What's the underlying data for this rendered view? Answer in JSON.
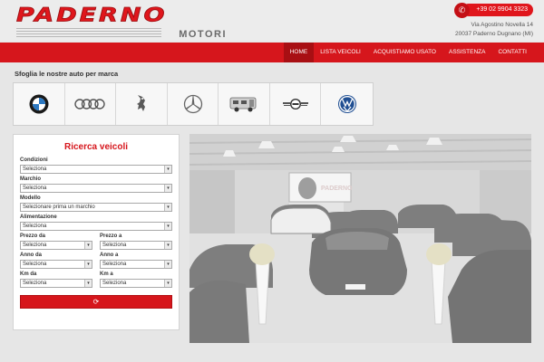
{
  "header": {
    "logo_main": "PADERNO",
    "logo_sub": "MOTORI",
    "phone": "+39 02 9904 3323",
    "address_line1": "Via Agostino Novella 14",
    "address_line2": "20037 Paderno Dugnano (MI)"
  },
  "nav": {
    "items": [
      "HOME",
      "LISTA VEICOLI",
      "ACQUISTIAMO USATO",
      "ASSISTENZA",
      "CONTATTI"
    ],
    "active": "HOME"
  },
  "brands": {
    "title": "Sfoglia le nostre auto per marca",
    "logos": [
      "bmw-logo",
      "audi-logo",
      "peugeot-logo",
      "mercedes-logo",
      "camper-logo",
      "mini-logo",
      "volkswagen-logo"
    ]
  },
  "search": {
    "title": "Ricerca veicoli",
    "fields": {
      "condizioni": {
        "label": "Condizioni",
        "value": "Seleziona"
      },
      "marchio": {
        "label": "Marchio",
        "value": "Seleziona"
      },
      "modello": {
        "label": "Modello",
        "value": "Selezionare prima un marchio"
      },
      "alimentazione": {
        "label": "Alimentazione",
        "value": "Seleziona"
      },
      "prezzo_da": {
        "label": "Prezzo da",
        "value": "Seleziona"
      },
      "prezzo_a": {
        "label": "Prezzo a",
        "value": "Seleziona"
      },
      "anno_da": {
        "label": "Anno da",
        "value": "Seleziona"
      },
      "anno_a": {
        "label": "Anno a",
        "value": "Seleziona"
      },
      "km_da": {
        "label": "Km da",
        "value": "Seleziona"
      },
      "km_a": {
        "label": "Km a",
        "value": "Seleziona"
      }
    }
  },
  "showroom": {
    "sign_text": "PADERNO"
  },
  "colors": {
    "brand_red": "#d6161c",
    "nav_active": "#a80f13",
    "page_bg": "#e6e6e6"
  }
}
